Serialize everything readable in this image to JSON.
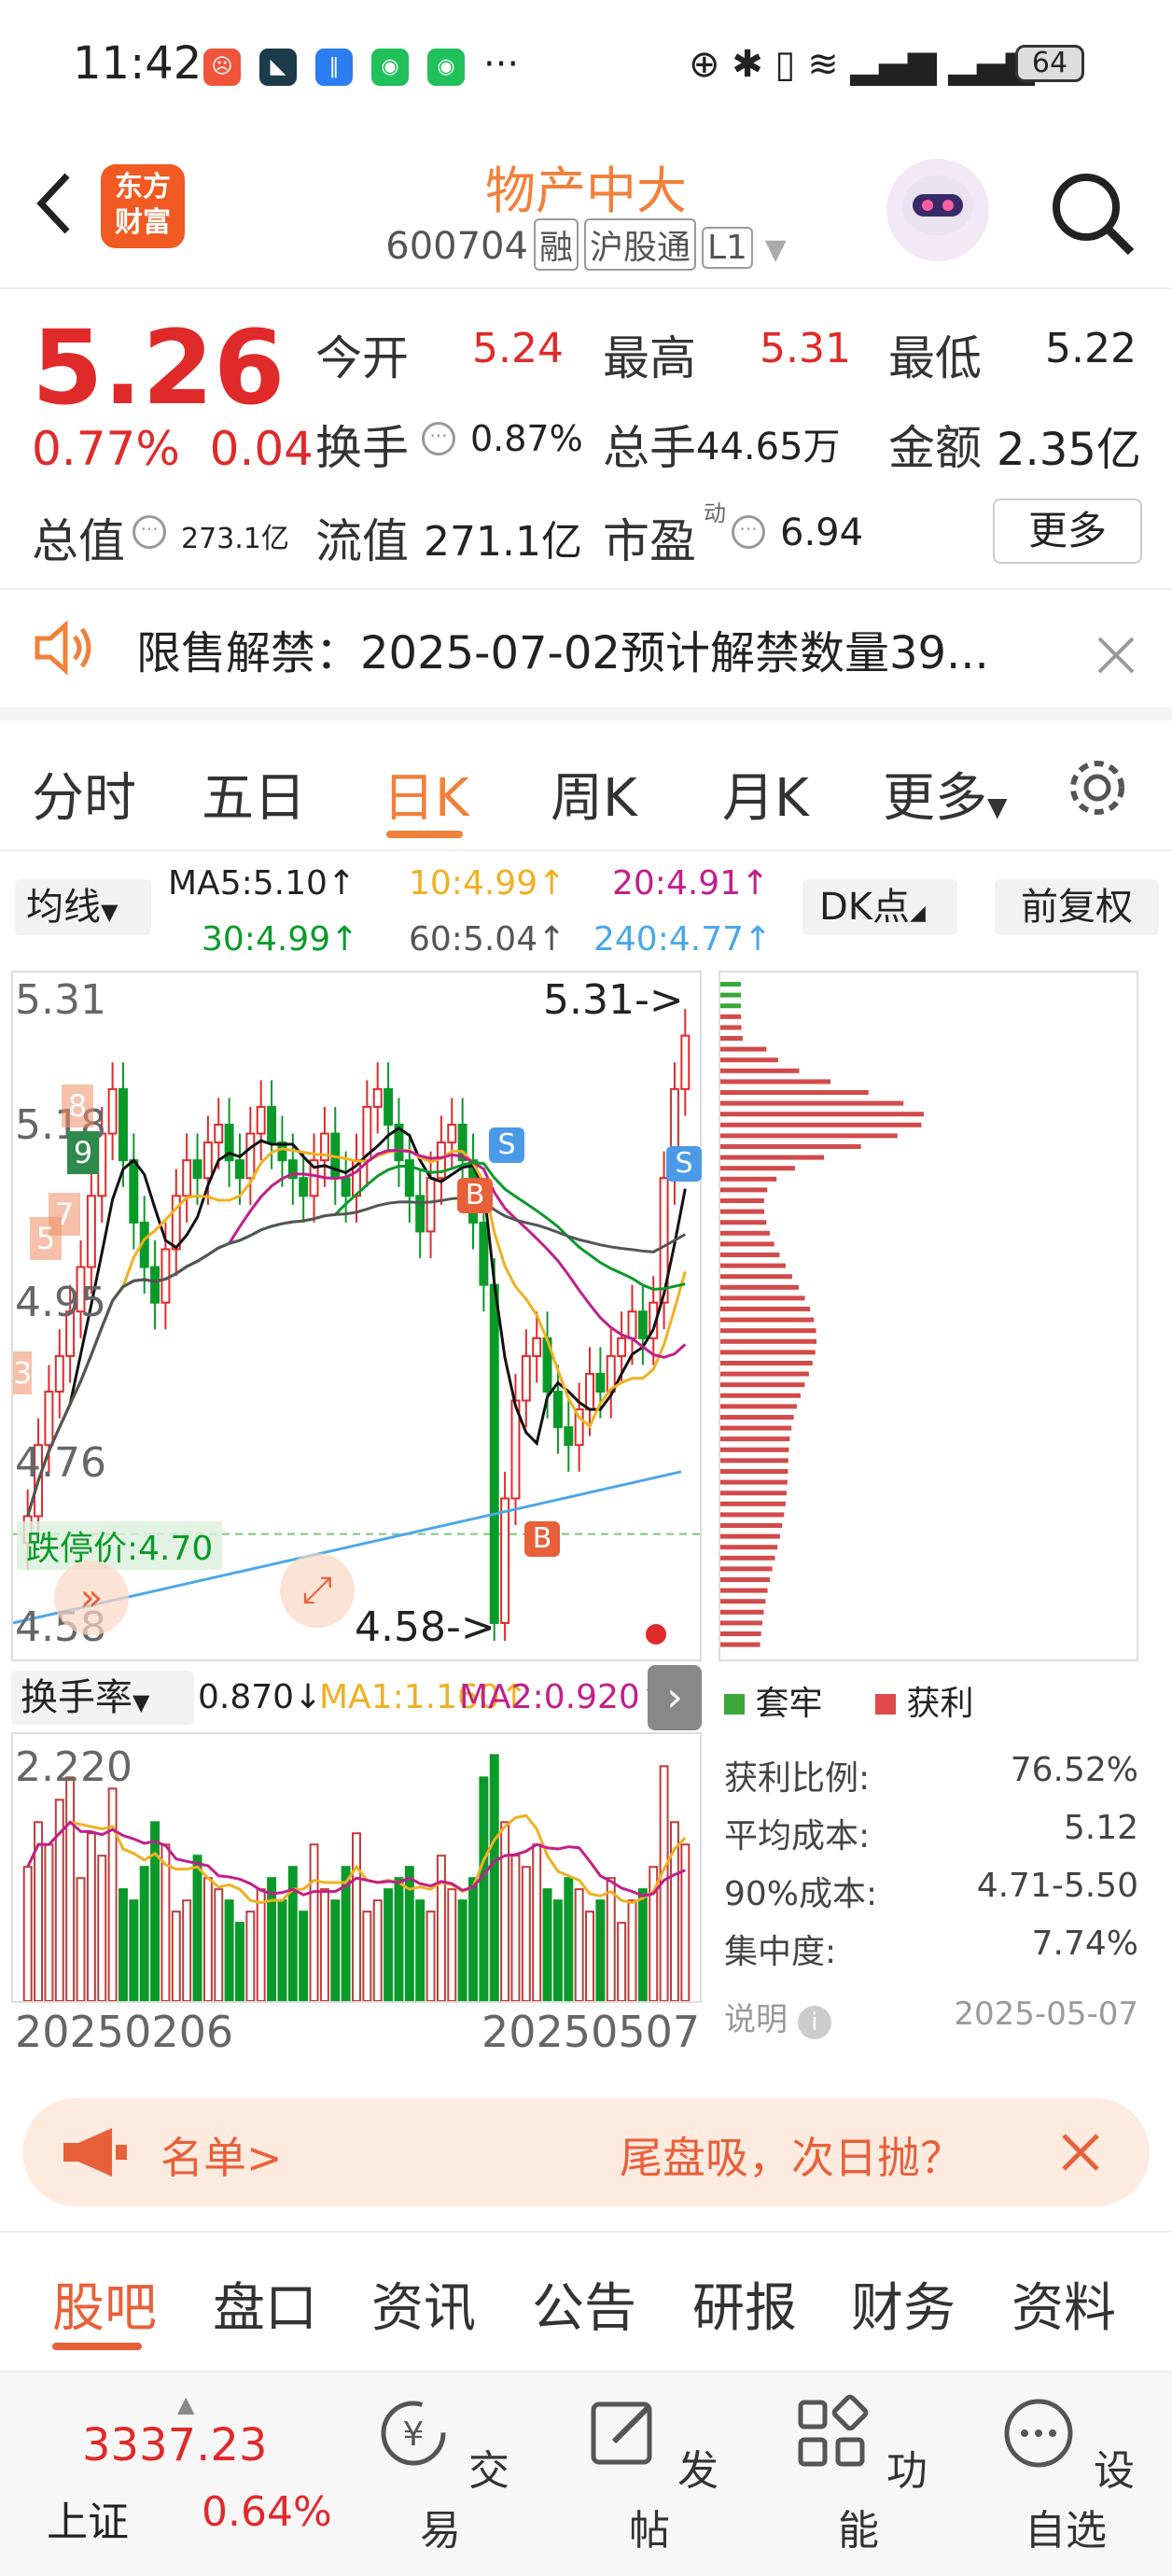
{
  "status_bar": {
    "time": "11:42",
    "battery": "64",
    "more": "···"
  },
  "header": {
    "title": "物产中大",
    "code": "600704",
    "tags": [
      "融",
      "沪股通",
      "L1"
    ]
  },
  "quote": {
    "price": "5.26",
    "change_pct": "0.77%",
    "change": "0.04",
    "open_label": "今开",
    "open": "5.24",
    "high_label": "最高",
    "high": "5.31",
    "low_label": "最低",
    "low": "5.22",
    "turnover_label": "换手",
    "turnover": "0.87%",
    "volume_label": "总手",
    "volume": "44.65万",
    "amount_label": "金额",
    "amount": "2.35亿",
    "mktcap_label": "总值",
    "mktcap": "273.1亿",
    "float_label": "流值",
    "float": "271.1亿",
    "pe_label": "市盈",
    "pe_sup": "动",
    "pe": "6.94",
    "more": "更多"
  },
  "notice": {
    "text": "限售解禁：2025-07-02预计解禁数量39..."
  },
  "chart_tabs": [
    "分时",
    "五日",
    "日K",
    "周K",
    "月K",
    "更多"
  ],
  "active_tab": "日K",
  "ma": {
    "selector": "均线",
    "ma5": "MA5:5.10↑",
    "ma10": "10:4.99↑",
    "ma20": "20:4.91↑",
    "ma30": "30:4.99↑",
    "ma60": "60:5.04↑",
    "ma240": "240:4.77↑",
    "dk": "DK点",
    "adjust": "前复权"
  },
  "kchart": {
    "y_labels": [
      "5.31",
      "5.18",
      "4.95",
      "4.76",
      "4.58"
    ],
    "high_label": "5.31->",
    "low_label": "4.58->",
    "limit_down": "跌停价:4.70",
    "markers": [
      "S",
      "S",
      "B",
      "B"
    ],
    "nums": [
      "8",
      "9",
      "7",
      "5",
      "3"
    ]
  },
  "chart_data": {
    "type": "candlestick",
    "ylim": [
      4.58,
      5.31
    ],
    "x_start": "20250206",
    "x_end": "20250507",
    "close": [
      4.72,
      4.8,
      4.86,
      4.9,
      4.95,
      5.0,
      5.08,
      5.15,
      5.2,
      5.12,
      5.05,
      5.0,
      4.96,
      5.02,
      5.08,
      5.12,
      5.1,
      5.14,
      5.16,
      5.12,
      5.1,
      5.15,
      5.18,
      5.14,
      5.12,
      5.1,
      5.08,
      5.12,
      5.15,
      5.1,
      5.08,
      5.12,
      5.18,
      5.2,
      5.16,
      5.12,
      5.08,
      5.04,
      5.1,
      5.14,
      5.16,
      5.12,
      5.05,
      4.98,
      4.6,
      4.74,
      4.85,
      4.9,
      4.92,
      4.86,
      4.82,
      4.8,
      4.84,
      4.88,
      4.86,
      4.9,
      4.92,
      4.95,
      4.92,
      4.96,
      5.1,
      5.2,
      5.26
    ],
    "volume": [
      1.2,
      1.6,
      1.4,
      1.8,
      2.0,
      1.1,
      1.5,
      1.3,
      1.9,
      1.0,
      0.9,
      1.2,
      1.6,
      1.4,
      0.8,
      0.9,
      1.3,
      1.1,
      1.0,
      0.9,
      0.7,
      0.8,
      1.0,
      1.1,
      0.9,
      1.2,
      0.8,
      1.4,
      1.0,
      0.9,
      1.2,
      1.5,
      0.8,
      0.9,
      1.0,
      1.1,
      1.2,
      0.9,
      0.8,
      1.3,
      1.0,
      0.9,
      1.1,
      2.0,
      2.2,
      1.6,
      1.3,
      1.2,
      1.4,
      1.0,
      0.9,
      1.1,
      1.0,
      0.8,
      0.9,
      1.1,
      0.7,
      0.9,
      1.0,
      1.2,
      2.1,
      1.6,
      1.4
    ],
    "vol_ylim": [
      0,
      2.22
    ]
  },
  "chip": {
    "legend_a": "套牢",
    "legend_b": "获利",
    "rows": [
      {
        "label": "获利比例:",
        "value": "76.52%"
      },
      {
        "label": "平均成本:",
        "value": "5.12"
      },
      {
        "label": "90%成本:",
        "value": "4.71-5.50"
      },
      {
        "label": "集中度:",
        "value": "7.74%"
      }
    ],
    "note": "说明",
    "date": "2025-05-07"
  },
  "volume_row": {
    "selector": "换手率",
    "v": "0.870↓",
    "ma1": "MA1:1.160↑",
    "ma2": "MA2:0.920↑",
    "top": "2.220"
  },
  "dates": {
    "start": "20250206",
    "end": "20250507"
  },
  "banner": {
    "left": "名单>",
    "right": "尾盘吸，次日抛？"
  },
  "bottom_tabs": [
    "股吧",
    "盘口",
    "资讯",
    "公告",
    "研报",
    "财务",
    "资料"
  ],
  "nav": {
    "index_value": "3337.23",
    "index_name": "上证",
    "index_chg": "0.64%",
    "items": [
      "交易",
      "发帖",
      "功能",
      "设自选"
    ]
  },
  "colors": {
    "up": "#e02a2a",
    "down": "#0a9a2a",
    "accent": "#f1803a"
  }
}
